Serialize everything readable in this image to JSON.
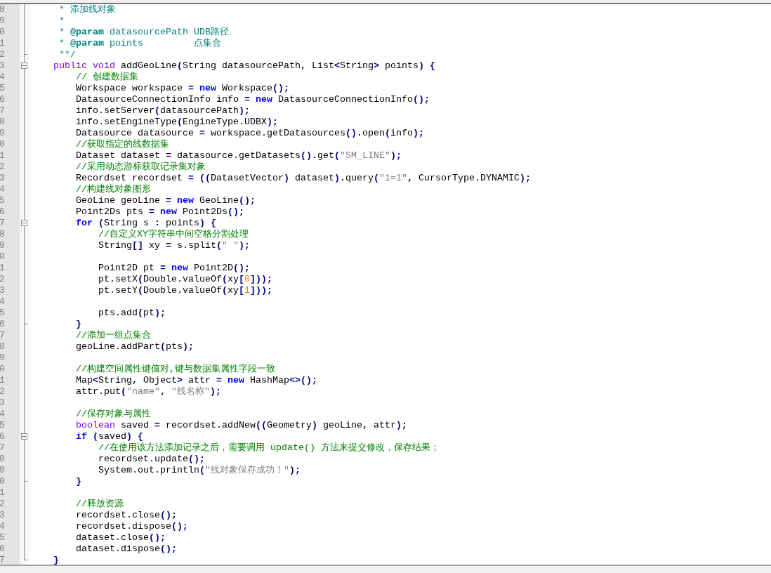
{
  "editor": {
    "lines": [
      {
        "number": "8",
        "kind": "plain",
        "tokens": [
          {
            "kind": "doc",
            "text": "     * 添加线对象"
          }
        ]
      },
      {
        "number": "9",
        "kind": "plain",
        "tokens": [
          {
            "kind": "doc",
            "text": "     *"
          }
        ]
      },
      {
        "number": "0",
        "kind": "plain",
        "tokens": [
          {
            "kind": "doc",
            "text": "     * "
          },
          {
            "kind": "tag",
            "text": "@param"
          },
          {
            "kind": "doc",
            "text": " datasourcePath UDB路径"
          }
        ]
      },
      {
        "number": "1",
        "kind": "plain",
        "tokens": [
          {
            "kind": "doc",
            "text": "     * "
          },
          {
            "kind": "tag",
            "text": "@param"
          },
          {
            "kind": "doc",
            "text": " points         点集合"
          }
        ]
      },
      {
        "number": "2",
        "kind": "closer",
        "tokens": [
          {
            "kind": "doc",
            "text": "     **/"
          }
        ]
      },
      {
        "number": "3",
        "kind": "opener",
        "expanded": true,
        "tokens": [
          {
            "kind": "type",
            "text": "    public "
          },
          {
            "kind": "type",
            "text": "void"
          },
          {
            "kind": "plain",
            "text": " addGeoLine"
          },
          {
            "kind": "operator",
            "text": "("
          },
          {
            "kind": "plain",
            "text": "String datasourcePath"
          },
          {
            "kind": "operator",
            "text": ","
          },
          {
            "kind": "plain",
            "text": " List"
          },
          {
            "kind": "operator",
            "text": "<"
          },
          {
            "kind": "plain",
            "text": "String"
          },
          {
            "kind": "operator",
            "text": ">"
          },
          {
            "kind": "plain",
            "text": " points"
          },
          {
            "kind": "operator",
            "text": ")"
          },
          {
            "kind": "operator",
            "text": " {"
          }
        ]
      },
      {
        "number": "4",
        "kind": "plain",
        "tokens": [
          {
            "kind": "comment",
            "text": "        // 创建数据集"
          }
        ]
      },
      {
        "number": "5",
        "kind": "plain",
        "tokens": [
          {
            "kind": "plain",
            "text": "        Workspace workspace "
          },
          {
            "kind": "operator",
            "text": "= "
          },
          {
            "kind": "keyword",
            "text": "new"
          },
          {
            "kind": "plain",
            "text": " Workspace"
          },
          {
            "kind": "operator",
            "text": "();"
          }
        ]
      },
      {
        "number": "6",
        "kind": "plain",
        "tokens": [
          {
            "kind": "plain",
            "text": "        DatasourceConnectionInfo info "
          },
          {
            "kind": "operator",
            "text": "= "
          },
          {
            "kind": "keyword",
            "text": "new"
          },
          {
            "kind": "plain",
            "text": " DatasourceConnectionInfo"
          },
          {
            "kind": "operator",
            "text": "();"
          }
        ]
      },
      {
        "number": "7",
        "kind": "plain",
        "tokens": [
          {
            "kind": "plain",
            "text": "        info.setServer"
          },
          {
            "kind": "operator",
            "text": "("
          },
          {
            "kind": "plain",
            "text": "datasourcePath"
          },
          {
            "kind": "operator",
            "text": ");"
          }
        ]
      },
      {
        "number": "8",
        "kind": "plain",
        "tokens": [
          {
            "kind": "plain",
            "text": "        info.setEngineType"
          },
          {
            "kind": "operator",
            "text": "("
          },
          {
            "kind": "plain",
            "text": "EngineType.UDBX"
          },
          {
            "kind": "operator",
            "text": ");"
          }
        ]
      },
      {
        "number": "9",
        "kind": "plain",
        "tokens": [
          {
            "kind": "plain",
            "text": "        Datasource datasource "
          },
          {
            "kind": "operator",
            "text": "="
          },
          {
            "kind": "plain",
            "text": " workspace.getDatasources"
          },
          {
            "kind": "operator",
            "text": "()."
          },
          {
            "kind": "plain",
            "text": "open"
          },
          {
            "kind": "operator",
            "text": "("
          },
          {
            "kind": "plain",
            "text": "info"
          },
          {
            "kind": "operator",
            "text": ");"
          }
        ]
      },
      {
        "number": "0",
        "kind": "plain",
        "tokens": [
          {
            "kind": "comment",
            "text": "        //获取指定的线数据集"
          }
        ]
      },
      {
        "number": "1",
        "kind": "plain",
        "tokens": [
          {
            "kind": "plain",
            "text": "        Dataset dataset "
          },
          {
            "kind": "operator",
            "text": "="
          },
          {
            "kind": "plain",
            "text": " datasource.getDatasets"
          },
          {
            "kind": "operator",
            "text": "()."
          },
          {
            "kind": "plain",
            "text": "get"
          },
          {
            "kind": "operator",
            "text": "("
          },
          {
            "kind": "string",
            "text": "\"SM_LINE\""
          },
          {
            "kind": "operator",
            "text": ");"
          }
        ]
      },
      {
        "number": "2",
        "kind": "plain",
        "tokens": [
          {
            "kind": "comment",
            "text": "        //采用动态游标获取记录集对象"
          }
        ]
      },
      {
        "number": "3",
        "kind": "plain",
        "tokens": [
          {
            "kind": "plain",
            "text": "        Recordset recordset "
          },
          {
            "kind": "operator",
            "text": "= (("
          },
          {
            "kind": "plain",
            "text": "DatasetVector"
          },
          {
            "kind": "operator",
            "text": ")"
          },
          {
            "kind": "plain",
            "text": " dataset"
          },
          {
            "kind": "operator",
            "text": ")."
          },
          {
            "kind": "plain",
            "text": "query"
          },
          {
            "kind": "operator",
            "text": "("
          },
          {
            "kind": "string",
            "text": "\"1=1\""
          },
          {
            "kind": "operator",
            "text": ","
          },
          {
            "kind": "plain",
            "text": " CursorType.DYNAMIC"
          },
          {
            "kind": "operator",
            "text": ");"
          }
        ]
      },
      {
        "number": "4",
        "kind": "plain",
        "tokens": [
          {
            "kind": "comment",
            "text": "        //构建线对象图形"
          }
        ]
      },
      {
        "number": "5",
        "kind": "plain",
        "tokens": [
          {
            "kind": "plain",
            "text": "        GeoLine geoLine "
          },
          {
            "kind": "operator",
            "text": "= "
          },
          {
            "kind": "keyword",
            "text": "new"
          },
          {
            "kind": "plain",
            "text": " GeoLine"
          },
          {
            "kind": "operator",
            "text": "();"
          }
        ]
      },
      {
        "number": "6",
        "kind": "plain",
        "tokens": [
          {
            "kind": "plain",
            "text": "        Point2Ds pts "
          },
          {
            "kind": "operator",
            "text": "= "
          },
          {
            "kind": "keyword",
            "text": "new"
          },
          {
            "kind": "plain",
            "text": " Point2Ds"
          },
          {
            "kind": "operator",
            "text": "();"
          }
        ]
      },
      {
        "number": "7",
        "kind": "opener",
        "expanded": true,
        "tokens": [
          {
            "kind": "keyword",
            "text": "        for"
          },
          {
            "kind": "operator",
            "text": " ("
          },
          {
            "kind": "plain",
            "text": "String s "
          },
          {
            "kind": "operator",
            "text": ":"
          },
          {
            "kind": "plain",
            "text": " points"
          },
          {
            "kind": "operator",
            "text": ") {"
          }
        ]
      },
      {
        "number": "8",
        "kind": "plain",
        "tokens": [
          {
            "kind": "comment",
            "text": "            //自定义XY字符串中间空格分割处理"
          }
        ]
      },
      {
        "number": "9",
        "kind": "plain",
        "tokens": [
          {
            "kind": "plain",
            "text": "            String"
          },
          {
            "kind": "operator",
            "text": "[]"
          },
          {
            "kind": "plain",
            "text": " xy "
          },
          {
            "kind": "operator",
            "text": "="
          },
          {
            "kind": "plain",
            "text": " s.split"
          },
          {
            "kind": "operator",
            "text": "("
          },
          {
            "kind": "string",
            "text": "\" \""
          },
          {
            "kind": "operator",
            "text": ");"
          }
        ]
      },
      {
        "number": "0",
        "kind": "plain"
      },
      {
        "number": "1",
        "kind": "plain",
        "tokens": [
          {
            "kind": "plain",
            "text": "            Point2D pt "
          },
          {
            "kind": "operator",
            "text": "= "
          },
          {
            "kind": "keyword",
            "text": "new"
          },
          {
            "kind": "plain",
            "text": " Point2D"
          },
          {
            "kind": "operator",
            "text": "();"
          }
        ]
      },
      {
        "number": "2",
        "kind": "plain",
        "tokens": [
          {
            "kind": "plain",
            "text": "            pt.setX"
          },
          {
            "kind": "operator",
            "text": "("
          },
          {
            "kind": "plain",
            "text": "Double.valueOf"
          },
          {
            "kind": "operator",
            "text": "("
          },
          {
            "kind": "plain",
            "text": "xy"
          },
          {
            "kind": "operator",
            "text": "["
          },
          {
            "kind": "number",
            "text": "0"
          },
          {
            "kind": "operator",
            "text": "]));"
          }
        ]
      },
      {
        "number": "3",
        "kind": "plain",
        "tokens": [
          {
            "kind": "plain",
            "text": "            pt.setY"
          },
          {
            "kind": "operator",
            "text": "("
          },
          {
            "kind": "plain",
            "text": "Double.valueOf"
          },
          {
            "kind": "operator",
            "text": "("
          },
          {
            "kind": "plain",
            "text": "xy"
          },
          {
            "kind": "operator",
            "text": "["
          },
          {
            "kind": "number",
            "text": "1"
          },
          {
            "kind": "operator",
            "text": "]));"
          }
        ]
      },
      {
        "number": "4",
        "kind": "plain"
      },
      {
        "number": "5",
        "kind": "plain",
        "tokens": [
          {
            "kind": "plain",
            "text": "            pts.add"
          },
          {
            "kind": "operator",
            "text": "("
          },
          {
            "kind": "plain",
            "text": "pt"
          },
          {
            "kind": "operator",
            "text": ");"
          }
        ]
      },
      {
        "number": "6",
        "kind": "closer",
        "tokens": [
          {
            "kind": "operator",
            "text": "        }"
          }
        ]
      },
      {
        "number": "7",
        "kind": "plain",
        "tokens": [
          {
            "kind": "comment",
            "text": "        //添加一组点集合"
          }
        ]
      },
      {
        "number": "8",
        "kind": "plain",
        "tokens": [
          {
            "kind": "plain",
            "text": "        geoLine.addPart"
          },
          {
            "kind": "operator",
            "text": "("
          },
          {
            "kind": "plain",
            "text": "pts"
          },
          {
            "kind": "operator",
            "text": ");"
          }
        ]
      },
      {
        "number": "9",
        "kind": "plain"
      },
      {
        "number": "0",
        "kind": "plain",
        "tokens": [
          {
            "kind": "comment",
            "text": "        //构建空间属性键值对,键与数据集属性字段一致"
          }
        ]
      },
      {
        "number": "1",
        "kind": "plain",
        "tokens": [
          {
            "kind": "plain",
            "text": "        Map"
          },
          {
            "kind": "operator",
            "text": "<"
          },
          {
            "kind": "plain",
            "text": "String"
          },
          {
            "kind": "operator",
            "text": ","
          },
          {
            "kind": "plain",
            "text": " Object"
          },
          {
            "kind": "operator",
            "text": ">"
          },
          {
            "kind": "plain",
            "text": " attr "
          },
          {
            "kind": "operator",
            "text": "= "
          },
          {
            "kind": "keyword",
            "text": "new"
          },
          {
            "kind": "plain",
            "text": " HashMap"
          },
          {
            "kind": "operator",
            "text": "<>();"
          }
        ]
      },
      {
        "number": "2",
        "kind": "plain",
        "tokens": [
          {
            "kind": "plain",
            "text": "        attr.put"
          },
          {
            "kind": "operator",
            "text": "("
          },
          {
            "kind": "string",
            "text": "\"name\""
          },
          {
            "kind": "operator",
            "text": ", "
          },
          {
            "kind": "string",
            "text": "\"线名称\""
          },
          {
            "kind": "operator",
            "text": ");"
          }
        ]
      },
      {
        "number": "3",
        "kind": "plain"
      },
      {
        "number": "4",
        "kind": "plain",
        "tokens": [
          {
            "kind": "comment",
            "text": "        //保存对象与属性"
          }
        ]
      },
      {
        "number": "5",
        "kind": "plain",
        "tokens": [
          {
            "kind": "type",
            "text": "        boolean"
          },
          {
            "kind": "plain",
            "text": " saved "
          },
          {
            "kind": "operator",
            "text": "="
          },
          {
            "kind": "plain",
            "text": " recordset.addNew"
          },
          {
            "kind": "operator",
            "text": "(("
          },
          {
            "kind": "plain",
            "text": "Geometry"
          },
          {
            "kind": "operator",
            "text": ")"
          },
          {
            "kind": "plain",
            "text": " geoLine"
          },
          {
            "kind": "operator",
            "text": ","
          },
          {
            "kind": "plain",
            "text": " attr"
          },
          {
            "kind": "operator",
            "text": ");"
          }
        ]
      },
      {
        "number": "6",
        "kind": "opener",
        "expanded": true,
        "tokens": [
          {
            "kind": "keyword",
            "text": "        if"
          },
          {
            "kind": "operator",
            "text": " ("
          },
          {
            "kind": "plain",
            "text": "saved"
          },
          {
            "kind": "operator",
            "text": ") {"
          }
        ]
      },
      {
        "number": "7",
        "kind": "plain",
        "tokens": [
          {
            "kind": "comment",
            "text": "            //在使用该方法添加记录之后，需要调用 update() 方法来提交修改，保存结果；"
          }
        ]
      },
      {
        "number": "8",
        "kind": "plain",
        "tokens": [
          {
            "kind": "plain",
            "text": "            recordset.update"
          },
          {
            "kind": "operator",
            "text": "();"
          }
        ]
      },
      {
        "number": "9",
        "kind": "plain",
        "tokens": [
          {
            "kind": "plain",
            "text": "            System.out.println"
          },
          {
            "kind": "operator",
            "text": "("
          },
          {
            "kind": "string",
            "text": "\"线对象保存成功！\""
          },
          {
            "kind": "operator",
            "text": ");"
          }
        ]
      },
      {
        "number": "0",
        "kind": "closer",
        "tokens": [
          {
            "kind": "operator",
            "text": "        }"
          }
        ]
      },
      {
        "number": "1",
        "kind": "plain"
      },
      {
        "number": "2",
        "kind": "plain",
        "tokens": [
          {
            "kind": "comment",
            "text": "        //释放资源"
          }
        ]
      },
      {
        "number": "3",
        "kind": "plain",
        "tokens": [
          {
            "kind": "plain",
            "text": "        recordset.close"
          },
          {
            "kind": "operator",
            "text": "();"
          }
        ]
      },
      {
        "number": "4",
        "kind": "plain",
        "tokens": [
          {
            "kind": "plain",
            "text": "        recordset.dispose"
          },
          {
            "kind": "operator",
            "text": "();"
          }
        ]
      },
      {
        "number": "5",
        "kind": "plain",
        "tokens": [
          {
            "kind": "plain",
            "text": "        dataset.close"
          },
          {
            "kind": "operator",
            "text": "();"
          }
        ]
      },
      {
        "number": "6",
        "kind": "plain",
        "tokens": [
          {
            "kind": "plain",
            "text": "        dataset.dispose"
          },
          {
            "kind": "operator",
            "text": "();"
          }
        ]
      },
      {
        "number": "7",
        "kind": "closer",
        "tokens": [
          {
            "kind": "operator",
            "text": "    }"
          }
        ]
      }
    ]
  }
}
